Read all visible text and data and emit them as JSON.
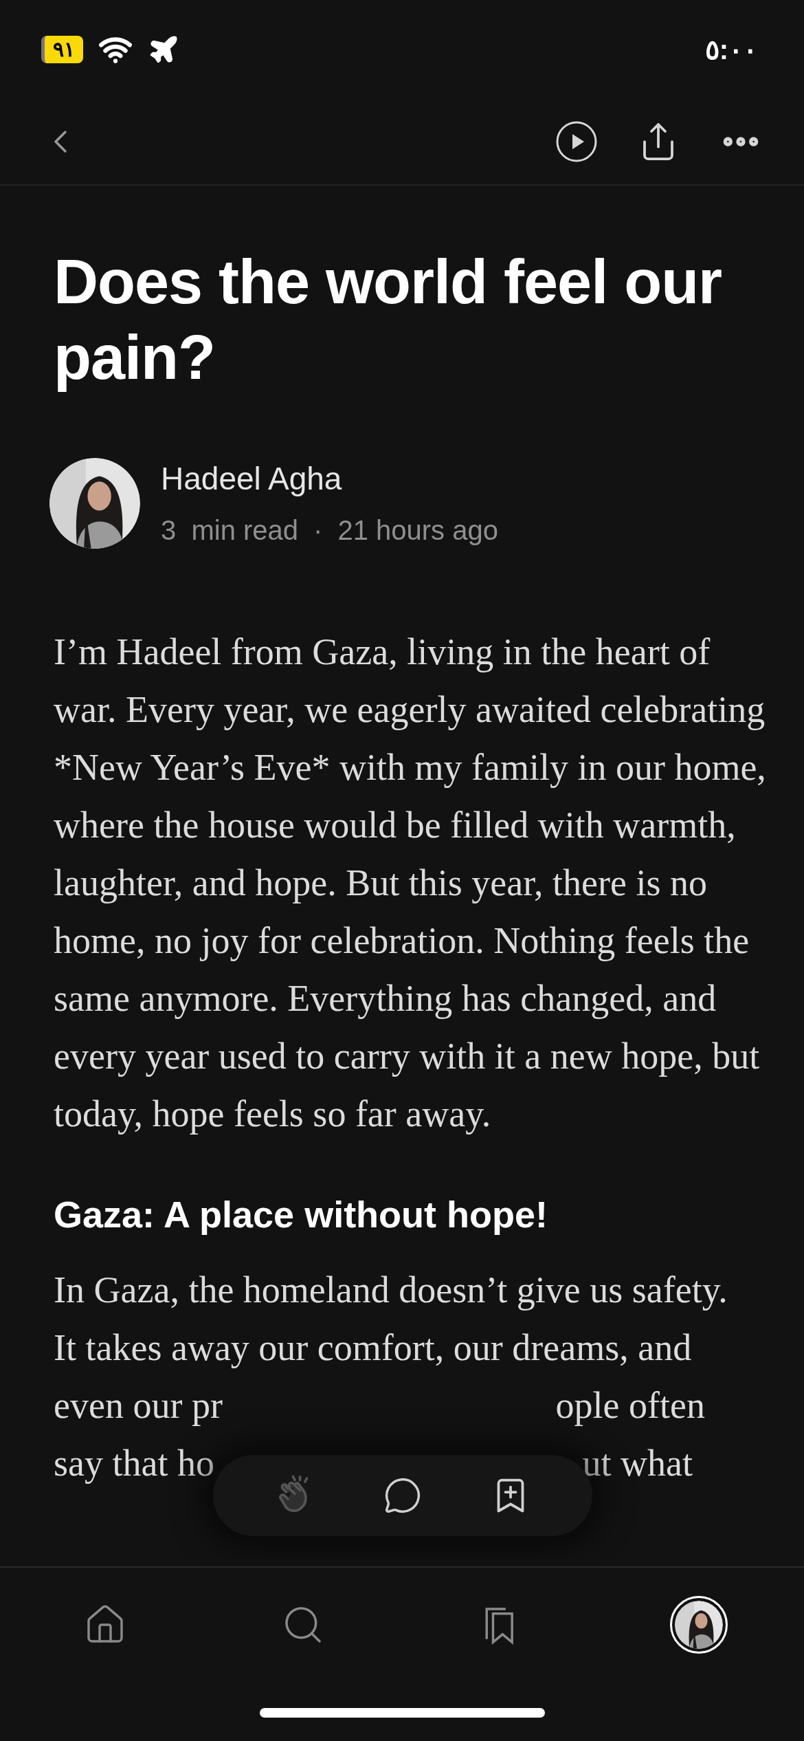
{
  "status_bar": {
    "battery": "٩١",
    "time": "٥:٠٠"
  },
  "article": {
    "title": "Does the world feel our pain?",
    "author": "Hadeel Agha",
    "read_time": "3  min read",
    "separator": "·",
    "published": "21 hours ago",
    "paragraph": "I’m Hadeel from Gaza, living in the heart of war. Every year, we eagerly awaited celebrating *New Year’s Eve* with my family in our home, where the house would be filled with warmth, laughter, and hope. But this year, there is no home, no joy for celebration. Nothing feels the same anymore. Everything has changed, and every year used to carry with it a new hope, but today, hope feels so far away.",
    "heading": "Gaza: A place without hope!",
    "lines": [
      {
        "left": "In Gaza, the homeland doesn’t give us safety."
      },
      {
        "left": "It takes away our comfort, our dreams, and"
      },
      {
        "left": "even our pr",
        "right": "ople often"
      },
      {
        "left": "say that ho",
        "right": "ut what"
      }
    ]
  },
  "actions": [
    {
      "kind": "clap",
      "disabled": true
    },
    {
      "kind": "comment",
      "disabled": false
    },
    {
      "kind": "save",
      "disabled": false
    }
  ],
  "tab_bar": [
    {
      "kind": "home",
      "selected": false
    },
    {
      "kind": "search",
      "selected": false
    },
    {
      "kind": "library",
      "selected": false
    },
    {
      "kind": "profile",
      "selected": true
    }
  ]
}
